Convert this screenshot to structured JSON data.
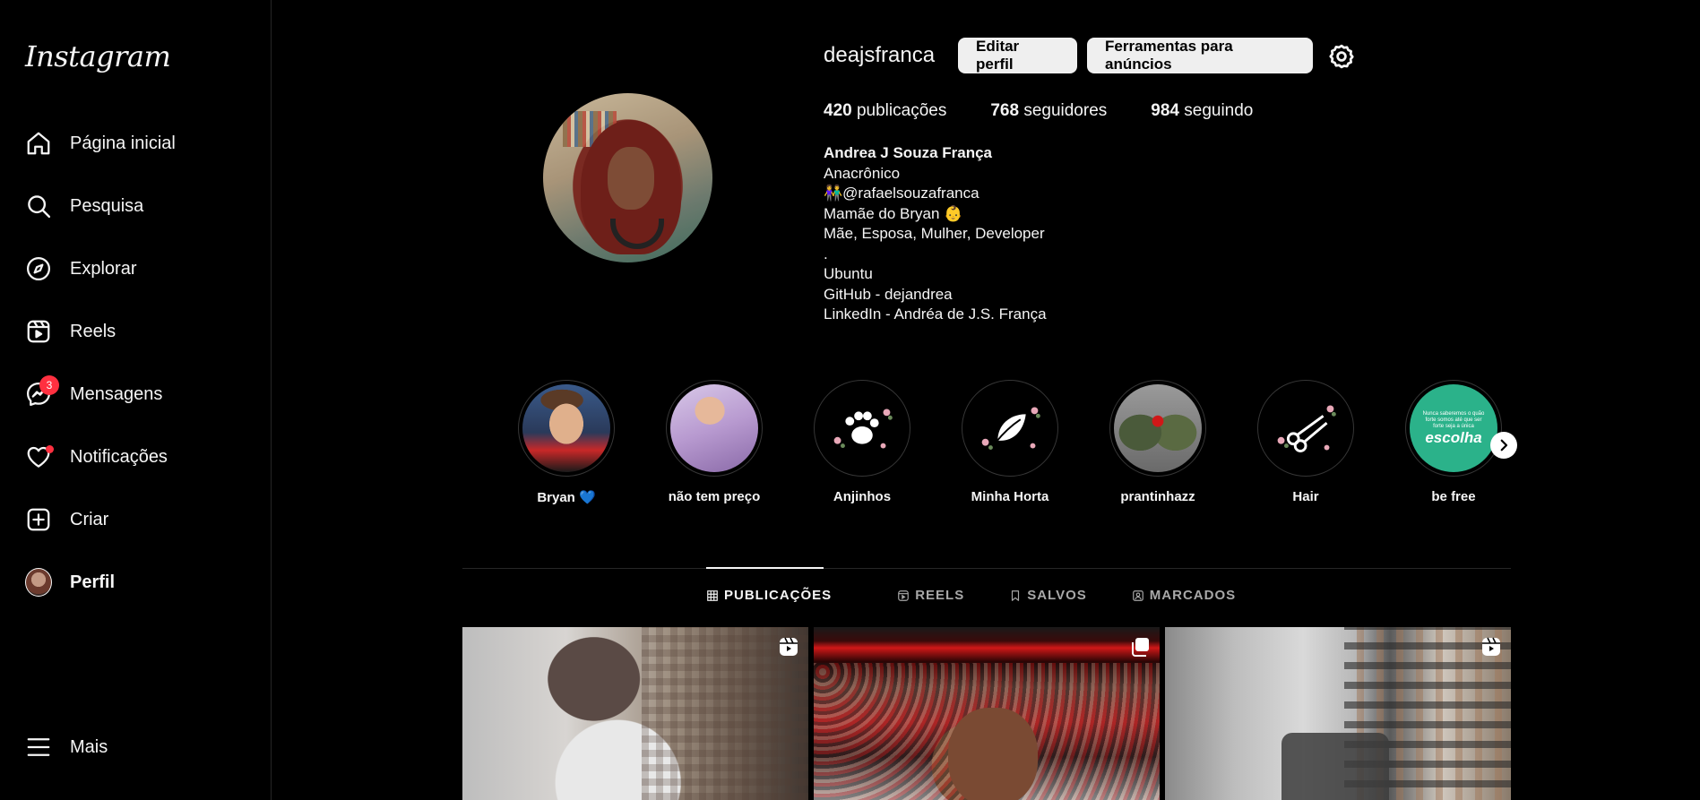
{
  "sidebar": {
    "logo": "Instagram",
    "items": [
      {
        "label": "Página inicial",
        "icon": "home-icon"
      },
      {
        "label": "Pesquisa",
        "icon": "search-icon"
      },
      {
        "label": "Explorar",
        "icon": "compass-icon"
      },
      {
        "label": "Reels",
        "icon": "reels-icon"
      },
      {
        "label": "Mensagens",
        "icon": "messenger-icon",
        "badge": "3"
      },
      {
        "label": "Notificações",
        "icon": "heart-icon"
      },
      {
        "label": "Criar",
        "icon": "plus-square-icon"
      },
      {
        "label": "Perfil",
        "icon": "avatar"
      }
    ],
    "more": "Mais"
  },
  "profile": {
    "username": "deajsfranca",
    "edit_button": "Editar perfil",
    "ads_button": "Ferramentas para anúncios",
    "stats": {
      "posts_count": "420",
      "posts_label": "publicações",
      "followers_count": "768",
      "followers_label": "seguidores",
      "following_count": "984",
      "following_label": "seguindo"
    },
    "bio": {
      "name": "Andrea J Souza França",
      "lines": [
        "Anacrônico",
        "👫@rafaelsouzafranca",
        "Mamãe do Bryan 👶",
        "Mãe, Esposa, Mulher, Developer",
        ".",
        "Ubuntu",
        "GitHub - dejandrea",
        "LinkedIn - Andréa de J.S. França"
      ]
    }
  },
  "highlights": [
    {
      "label": "Bryan 💙"
    },
    {
      "label": "não tem preço"
    },
    {
      "label": "Anjinhos"
    },
    {
      "label": "Minha Horta"
    },
    {
      "label": "prantinhazz"
    },
    {
      "label": "Hair"
    },
    {
      "label": "be free",
      "text": "escolha",
      "small_text": "Nunca saberemos o quão forte somos até que ser forte seja a única"
    }
  ],
  "tabs": [
    {
      "label": "PUBLICAÇÕES",
      "icon": "grid-icon",
      "active": true
    },
    {
      "label": "REELS",
      "icon": "reels-icon"
    },
    {
      "label": "SALVOS",
      "icon": "bookmark-icon"
    },
    {
      "label": "MARCADOS",
      "icon": "tagged-icon"
    }
  ],
  "posts": [
    {
      "type": "reel",
      "icon": "reel-icon"
    },
    {
      "type": "carousel",
      "icon": "carousel-icon"
    },
    {
      "type": "reel",
      "icon": "reel-icon"
    }
  ],
  "colors": {
    "background": "#000000",
    "text": "#f5f5f5",
    "button_bg": "#efefef",
    "badge": "#ff3040",
    "muted": "#a8a8a8",
    "divider": "#262626"
  }
}
